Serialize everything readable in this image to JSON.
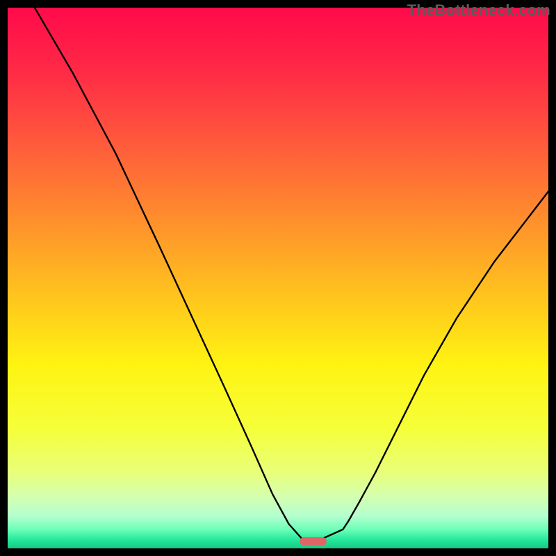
{
  "watermark": "TheBottleneck.com",
  "chart_data": {
    "type": "line",
    "title": "",
    "xlabel": "",
    "ylabel": "",
    "xlim": [
      0,
      100
    ],
    "ylim": [
      0,
      100
    ],
    "grid": false,
    "series": [
      {
        "name": "curve",
        "x": [
          5,
          12,
          20,
          28,
          34,
          40,
          45,
          49,
          52,
          54.5,
          56,
          57,
          58,
          62,
          63,
          65,
          68,
          72,
          77,
          83,
          90,
          100
        ],
        "values": [
          100,
          88,
          73,
          56,
          43,
          30,
          19,
          10,
          4.5,
          1.7,
          1.3,
          1.3,
          1.7,
          3.5,
          5,
          8.5,
          14,
          22,
          32,
          42.5,
          53,
          66
        ]
      }
    ],
    "marker": {
      "name": "sweet-spot",
      "center_x": 56.5,
      "y": 1.3,
      "width": 4.5,
      "color": "#e06666"
    },
    "background_gradient": {
      "direction": "vertical",
      "stops": [
        {
          "pos": 0.0,
          "color": "#ff0a4a"
        },
        {
          "pos": 0.12,
          "color": "#ff2b46"
        },
        {
          "pos": 0.25,
          "color": "#ff5a3c"
        },
        {
          "pos": 0.38,
          "color": "#ff8a2e"
        },
        {
          "pos": 0.52,
          "color": "#ffbf1f"
        },
        {
          "pos": 0.66,
          "color": "#fff312"
        },
        {
          "pos": 0.78,
          "color": "#f5ff3a"
        },
        {
          "pos": 0.86,
          "color": "#e8ff7a"
        },
        {
          "pos": 0.9,
          "color": "#d7ffab"
        },
        {
          "pos": 0.94,
          "color": "#b4ffcf"
        },
        {
          "pos": 0.965,
          "color": "#6cffb8"
        },
        {
          "pos": 0.985,
          "color": "#22e79a"
        },
        {
          "pos": 1.0,
          "color": "#18c884"
        }
      ]
    }
  }
}
